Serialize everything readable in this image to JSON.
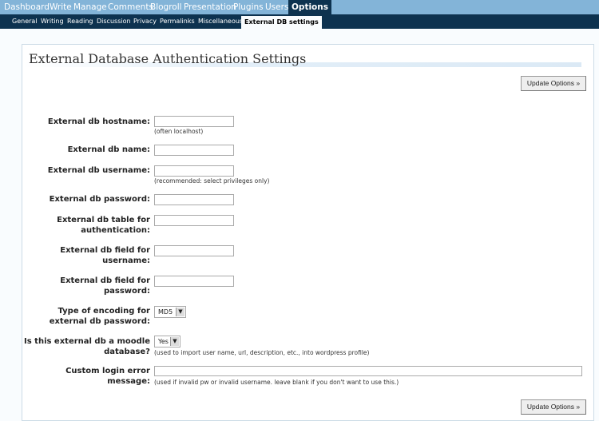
{
  "admin_menu": {
    "items": [
      "Dashboard",
      "Write",
      "Manage",
      "Comments",
      "Blogroll",
      "Presentation",
      "Plugins",
      "Users",
      "Options"
    ],
    "current": "Options"
  },
  "sub_menu": {
    "items": [
      "General",
      "Writing",
      "Reading",
      "Discussion",
      "Privacy",
      "Permalinks",
      "Miscellaneous",
      "External DB settings"
    ],
    "current": "External DB settings"
  },
  "page": {
    "title": "External Database Authentication Settings",
    "update_button": "Update Options »"
  },
  "fields": [
    {
      "label": "External db hostname:",
      "value": "",
      "hint": "(often localhost)"
    },
    {
      "label": "External db name:",
      "value": ""
    },
    {
      "label": "External db username:",
      "value": "",
      "hint": "(recommended: select privileges only)"
    },
    {
      "label": "External db password:",
      "value": ""
    },
    {
      "label": "External db table for authentication:",
      "value": ""
    },
    {
      "label": "External db field for username:",
      "value": ""
    },
    {
      "label": "External db field for password:",
      "value": ""
    },
    {
      "label": "Type of encoding for external db password:",
      "value": "MD5"
    },
    {
      "label": "Is this external db a moodle database?",
      "value": "Yes",
      "hint": "(used to import user name, url, description, etc., into wordpress profile)"
    },
    {
      "label": "Custom login error message:",
      "value": "",
      "hint": "(used if invalid pw or invalid username. leave blank if you don't want to use this.)"
    }
  ],
  "colors": {
    "menu_bg": "#83b4d8",
    "submenu_bg": "#0d324f",
    "current_tab": "#0d324f",
    "page_bg": "#f9fcfe"
  }
}
